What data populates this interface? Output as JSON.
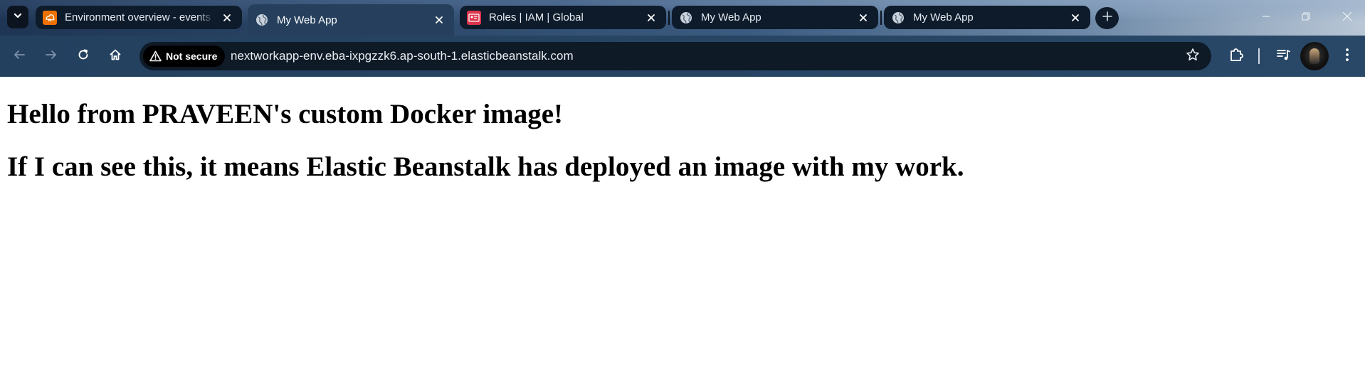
{
  "tabs": [
    {
      "title": "Environment overview - events",
      "favicon": "aws-beanstalk-icon",
      "active": false
    },
    {
      "title": "My Web App",
      "favicon": "globe-icon",
      "active": true
    },
    {
      "title": "Roles | IAM | Global",
      "favicon": "aws-iam-icon",
      "active": false
    },
    {
      "title": "My Web App",
      "favicon": "globe-icon",
      "active": false
    },
    {
      "title": "My Web App",
      "favicon": "globe-icon",
      "active": false
    }
  ],
  "toolbar": {
    "security_label": "Not secure",
    "url": "nextworkapp-env.eba-ixpgzzk6.ap-south-1.elasticbeanstalk.com"
  },
  "page": {
    "heading1": "Hello from PRAVEEN's custom Docker image!",
    "heading2": "If I can see this, it means Elastic Beanstalk has deployed an image with my work."
  },
  "colors": {
    "beanstalk_orange": "#ed7100",
    "iam_red": "#dd344c",
    "omnibox_bg": "#0f1a27"
  }
}
